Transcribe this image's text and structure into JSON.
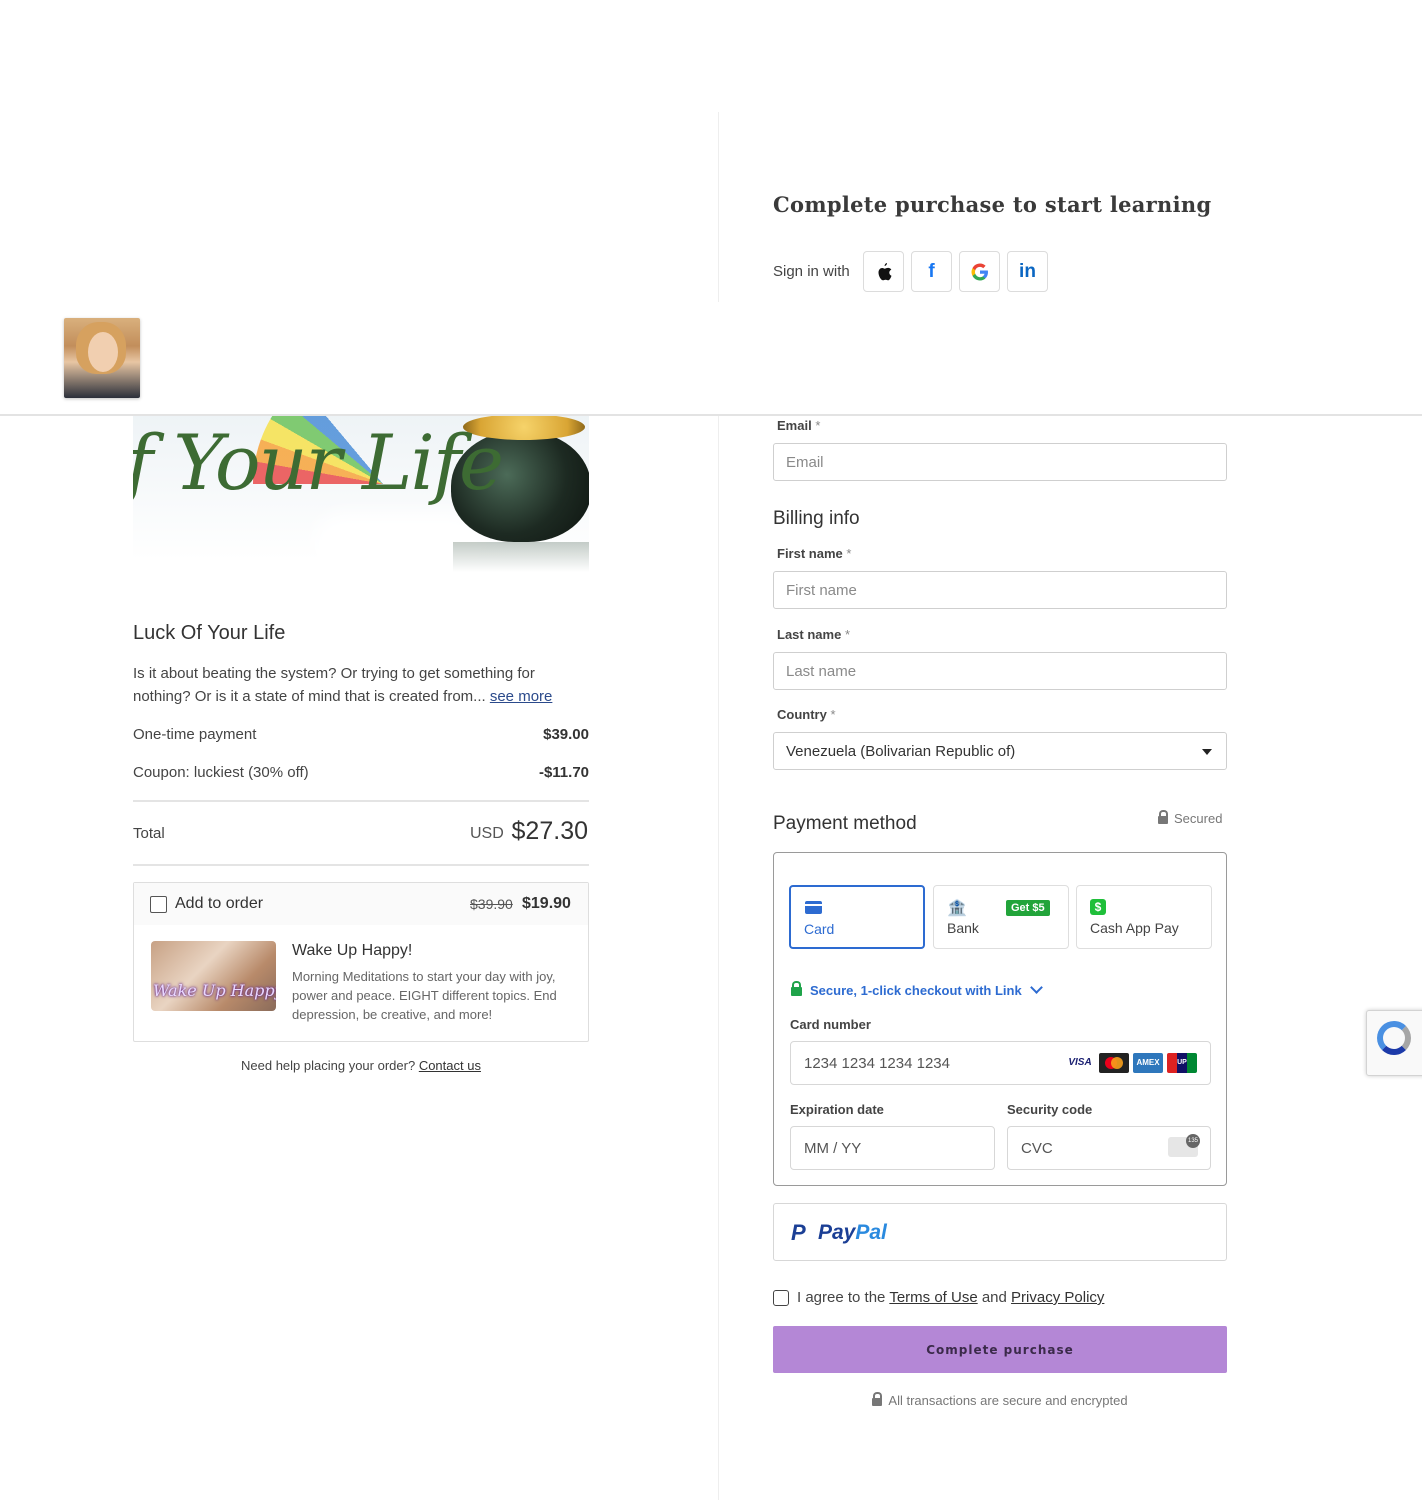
{
  "header": {
    "avatar_alt": "instructor avatar"
  },
  "product": {
    "title": "Luck Of Your Life",
    "hero_script": "f Your Life",
    "description": "Is it about beating the system? Or trying to get something for nothing? Or is it a state of mind that is created from...",
    "see_more": "see more"
  },
  "summary": {
    "one_time_label": "One-time payment",
    "one_time_value": "$39.00",
    "coupon_label": "Coupon: luckiest (30% off)",
    "coupon_value": "-$11.70",
    "total_label": "Total",
    "total_currency": "USD",
    "total_value": "$27.30"
  },
  "upsell": {
    "add_label": "Add to order",
    "old_price": "$39.90",
    "new_price": "$19.90",
    "thumb_text": "Wake Up Happy!",
    "title": "Wake Up Happy!",
    "description": "Morning Meditations to start your day with joy, power and peace. EIGHT different topics. End depression, be creative, and more!"
  },
  "help": {
    "text": "Need help placing your order?",
    "link": "Contact us"
  },
  "checkout": {
    "title": "Complete purchase to start learning",
    "signin_label": "Sign in with",
    "social": {
      "apple": "",
      "facebook": "f",
      "google": "G",
      "linkedin": "in"
    }
  },
  "form": {
    "email_label": "Email",
    "email_placeholder": "Email",
    "billing_title": "Billing info",
    "first_name_label": "First name",
    "first_name_placeholder": "First name",
    "last_name_label": "Last name",
    "last_name_placeholder": "Last name",
    "country_label": "Country",
    "country_value": "Venezuela (Bolivarian Republic of)",
    "required_mark": "*"
  },
  "payment": {
    "title": "Payment method",
    "secured": "Secured",
    "tabs": {
      "card": "Card",
      "bank": "Bank",
      "bank_badge": "Get $5",
      "cashapp": "Cash App Pay",
      "cashapp_glyph": "$"
    },
    "link_text": "Secure, 1-click checkout with Link",
    "card_number_label": "Card number",
    "card_number_placeholder": "1234 1234 1234 1234",
    "brands": {
      "visa": "VISA",
      "amex": "AMEX",
      "unionpay": "UP"
    },
    "expiry_label": "Expiration date",
    "expiry_placeholder": "MM / YY",
    "cvc_label": "Security code",
    "cvc_placeholder": "CVC"
  },
  "paypal": {
    "pay": "Pay",
    "pal": "Pal",
    "mark": "P"
  },
  "agreement": {
    "prefix": "I agree to the",
    "terms": "Terms of Use",
    "and": "and",
    "privacy": "Privacy Policy"
  },
  "actions": {
    "complete": "Complete purchase"
  },
  "footer_note": "All transactions are secure and encrypted",
  "colors": {
    "accent": "#b487d6",
    "link_blue": "#2d6bd1",
    "green": "#1fa34a"
  }
}
